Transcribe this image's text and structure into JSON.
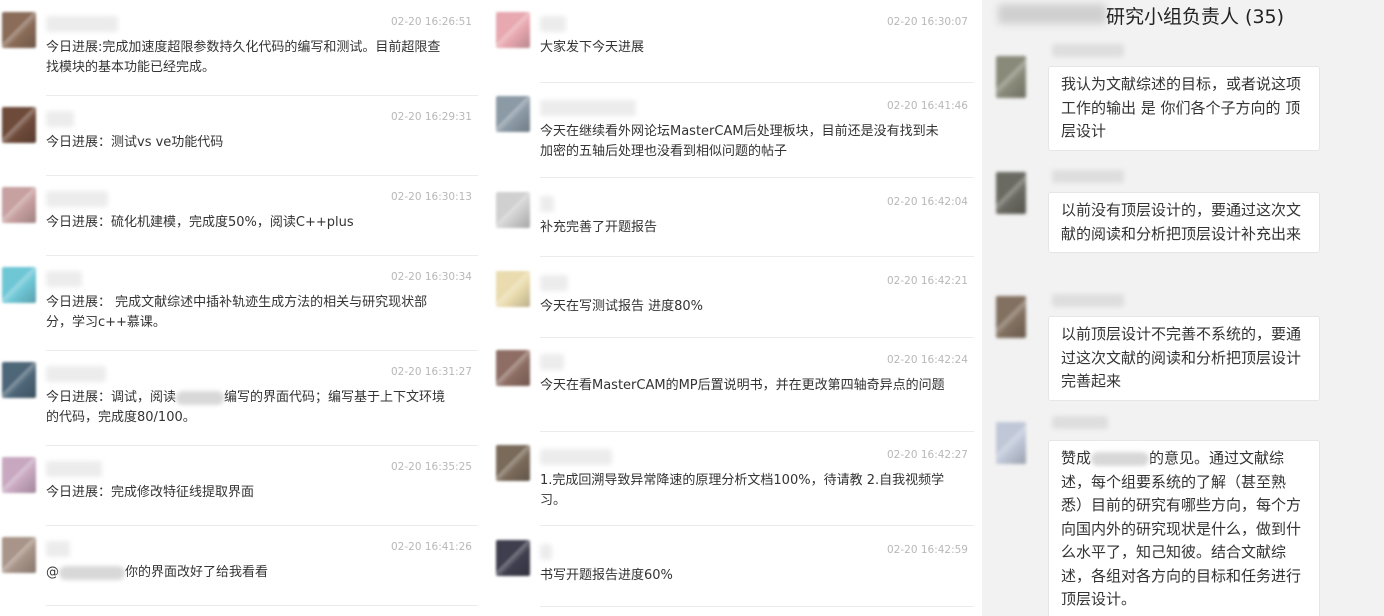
{
  "left_feed": [
    {
      "time": "02-20 16:26:51",
      "text": "今日进展:完成加速度超限参数持久化代码的编写和测试。目前超限查找模块的基本功能已经完成。",
      "avatar_color": "#8a6c58"
    },
    {
      "time": "02-20 16:29:31",
      "text": "今日进展：测试vs ve功能代码",
      "avatar_color": "#6e4a3a"
    },
    {
      "time": "02-20 16:30:13",
      "text": "今日进展：硫化机建模，完成度50%，阅读C++plus",
      "avatar_color": "#c7a0a0"
    },
    {
      "time": "02-20 16:30:34",
      "text": "今日进展： 完成文献综述中插补轨迹生成方法的相关与研究现状部分，学习c++慕课。",
      "avatar_color": "#6fc7d6"
    },
    {
      "time": "02-20 16:31:27",
      "text_before": "今日进展：调试，阅读",
      "text_after": "编写的界面代码；编写基于上下文环境的代码，完成度80/100。",
      "avatar_color": "#4d6678"
    },
    {
      "time": "02-20 16:35:25",
      "text": "今日进展：完成修改特征线提取界面",
      "avatar_color": "#c8a8c0"
    },
    {
      "time": "02-20 16:41:26",
      "text_before": "@",
      "text_after": "你的界面改好了给我看看",
      "avatar_color": "#a89488"
    }
  ],
  "middle_feed": [
    {
      "time": "02-20 16:30:07",
      "text": "大家发下今天进展",
      "avatar_color": "#e8a8b0"
    },
    {
      "time": "02-20 16:41:46",
      "text": "今天在继续看外网论坛MasterCAM后处理板块，目前还是没有找到未加密的五轴后处理也没看到相似问题的帖子",
      "avatar_color": "#8c9aa6"
    },
    {
      "time": "02-20 16:42:04",
      "text": "补充完善了开题报告",
      "avatar_color": "#d0d0d0"
    },
    {
      "time": "02-20 16:42:21",
      "text": "今天在写测试报告 进度80%",
      "avatar_color": "#eadcae"
    },
    {
      "time": "02-20 16:42:24",
      "text": "今天在看MasterCAM的MP后置说明书，并在更改第四轴奇异点的问题",
      "avatar_color": "#8e6e64"
    },
    {
      "time": "02-20 16:42:27",
      "text": "1.完成回溯导致异常降速的原理分析文档100%，待请教 2.自我视频学习。",
      "avatar_color": "#7a6a5a"
    },
    {
      "time": "02-20 16:42:59",
      "text": "书写开题报告进度60%",
      "avatar_color": "#3e3e4e"
    }
  ],
  "right_panel": {
    "title": "研究小组负责人 (35)",
    "messages": [
      {
        "text": "我认为文献综述的目标，或者说这项工作的输出 是 你们各个子方向的 顶层设计",
        "avatar_color": "#8a8a7a"
      },
      {
        "text": "以前没有顶层设计的，要通过这次文献的阅读和分析把顶层设计补充出来",
        "avatar_color": "#6a6a62"
      },
      {
        "text": "以前顶层设计不完善不系统的，要通过这次文献的阅读和分析把顶层设计完善起来",
        "avatar_color": "#827060"
      },
      {
        "text_before": "赞成",
        "text_after": "的意见。通过文献综述，每个组要系统的了解（甚至熟悉）目前的研究有哪些方向，每个方向国内外的研究现状是什么，做到什么水平了，知己知彼。结合文献综述，各组对各方向的目标和任务进行顶层设计。",
        "avatar_color": "#c0c8d8"
      }
    ]
  }
}
